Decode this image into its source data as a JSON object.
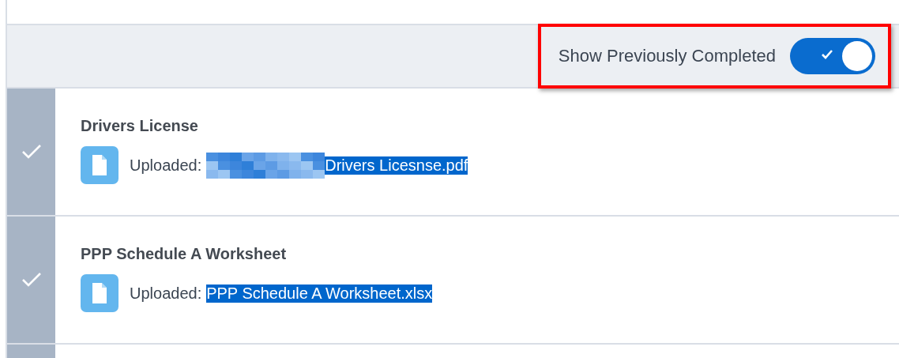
{
  "toolbar": {
    "toggle": {
      "label": "Show Previously Completed",
      "on": true
    },
    "annotation_frame": true
  },
  "items": [
    {
      "title": "Drivers License",
      "done": true,
      "uploaded_label": "Uploaded:",
      "redacted": true,
      "file": "Drivers Licesnse.pdf",
      "file_selected": true
    },
    {
      "title": "PPP Schedule A Worksheet",
      "done": true,
      "uploaded_label": "Uploaded:",
      "redacted": false,
      "file": "PPP Schedule A Worksheet.xlsx",
      "file_selected": true
    }
  ]
}
